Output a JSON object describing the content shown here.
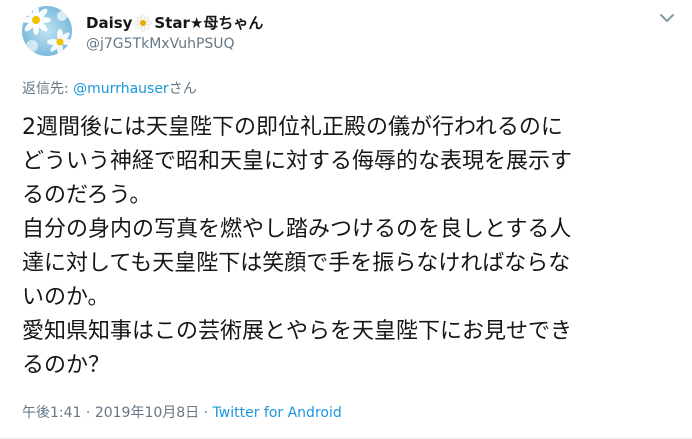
{
  "user": {
    "name_prefix": "Daisy",
    "name_suffix": "Star★母ちゃん",
    "handle": "@j7G5TkMxVuhPSUQ"
  },
  "reply": {
    "prefix": "返信先: ",
    "mention": "@murrhauser",
    "suffix": "さん"
  },
  "tweet": {
    "lines": [
      "2週間後には天皇陛下の即位礼正殿の儀が行われるのに",
      "どういう神経で昭和天皇に対する侮辱的な表現を展示す",
      "るのだろう。",
      "自分の身内の写真を燃やし踏みつけるのを良しとする人",
      "達に対しても天皇陛下は笑顔で手を振らなければならな",
      "いのか。",
      "愛知県知事はこの芸術展とやらを天皇陛下にお見せでき",
      "るのか？"
    ]
  },
  "meta": {
    "time": "午後1:41",
    "sep1": " · ",
    "date": "2019年10月8日",
    "sep2": " · ",
    "source": "Twitter for Android"
  },
  "icons": {
    "avatar": "daisy-flower-photo",
    "name_emoji": "flower-icon",
    "more": "chevron-down-icon"
  },
  "colors": {
    "text": "#14171a",
    "secondary": "#657786",
    "link": "#1b95e0"
  }
}
